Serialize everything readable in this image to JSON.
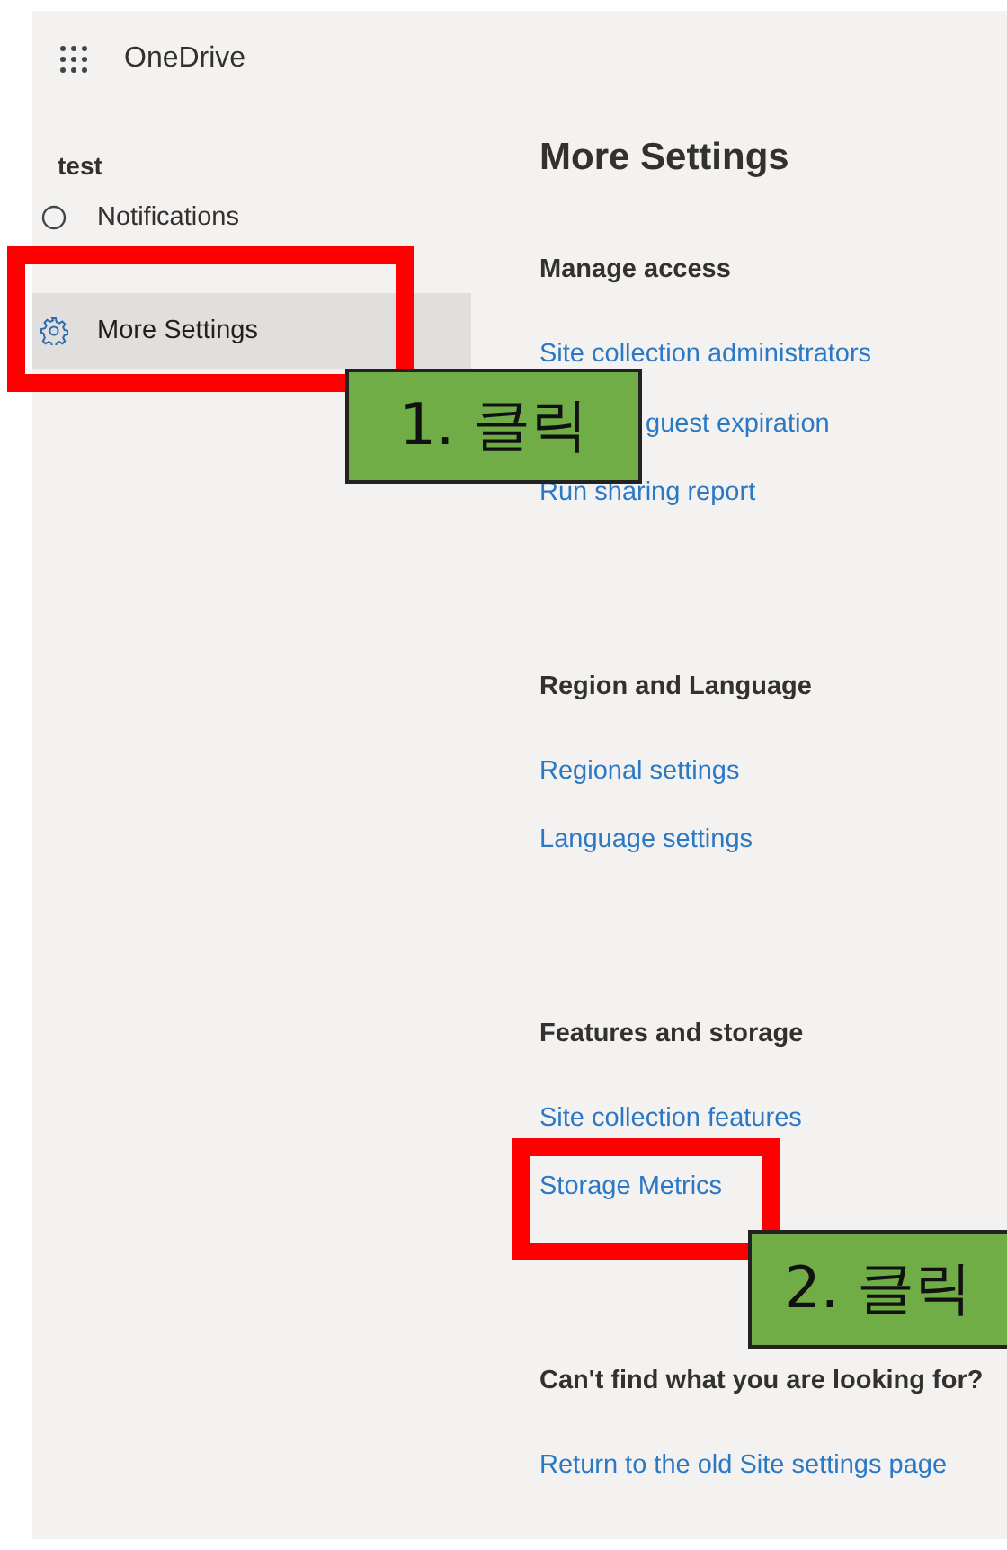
{
  "app": {
    "title": "OneDrive"
  },
  "sidebar": {
    "site": "test",
    "items": [
      {
        "label": "Notifications",
        "selected": false
      },
      {
        "label": "More Settings",
        "selected": true
      }
    ]
  },
  "main": {
    "title": "More Settings",
    "sections": [
      {
        "heading": "Manage access",
        "links": [
          "Site collection administrators",
          "guest expiration",
          "Run sharing report"
        ]
      },
      {
        "heading": "Region and Language",
        "links": [
          "Regional settings",
          "Language settings"
        ]
      },
      {
        "heading": "Features and storage",
        "links": [
          "Site collection features",
          "Storage Metrics"
        ]
      },
      {
        "heading": "Can't find what you are looking for?",
        "links": [
          "Return to the old Site settings page"
        ]
      }
    ]
  },
  "annotations": [
    {
      "kind": "highlight"
    },
    {
      "kind": "callout",
      "text": "1. 클릭"
    },
    {
      "kind": "highlight"
    },
    {
      "kind": "callout",
      "text": "2. 클릭"
    }
  ]
}
